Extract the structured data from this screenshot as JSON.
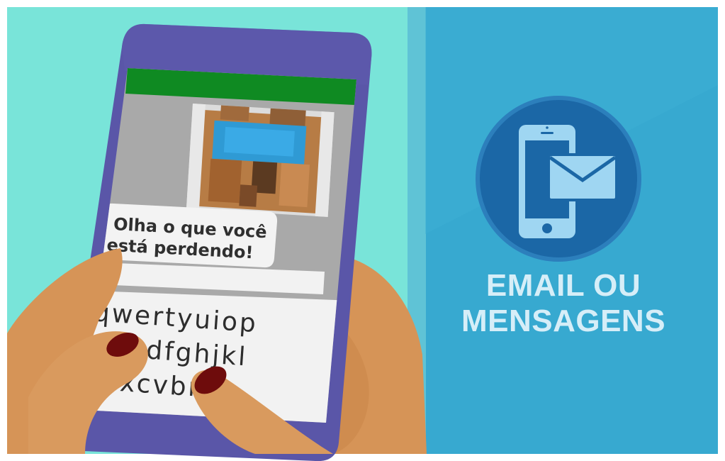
{
  "message": {
    "line1": "Olha o que você",
    "line2": "está perdendo!"
  },
  "keyboard": {
    "row1": "qwertyuiop",
    "row2": "dfghjkl",
    "row3": "xcvbnm"
  },
  "caption": {
    "line1": "EMAIL OU",
    "line2": "MENSAGENS"
  },
  "icons": [
    "phone-envelope-icon"
  ],
  "colors": {
    "left_background": "#79e4d9",
    "right_background": "#37a9d0",
    "phone_body": "#5a56a8",
    "app_header": "#0f8a22",
    "icon_circle": "#1b67a6",
    "caption_text": "#d6eef8",
    "nail_polish": "#6e0c0c"
  }
}
